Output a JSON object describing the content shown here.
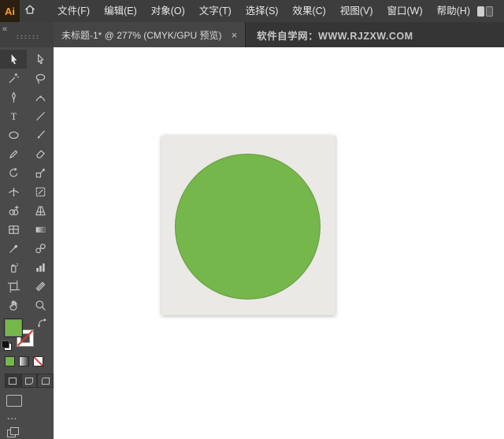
{
  "app": {
    "logo_text": "Ai"
  },
  "menubar": {
    "items": [
      {
        "id": "file",
        "label": "文件(F)"
      },
      {
        "id": "edit",
        "label": "编辑(E)"
      },
      {
        "id": "object",
        "label": "对象(O)"
      },
      {
        "id": "type",
        "label": "文字(T)"
      },
      {
        "id": "select",
        "label": "选择(S)"
      },
      {
        "id": "effect",
        "label": "效果(C)"
      },
      {
        "id": "view",
        "label": "视图(V)"
      },
      {
        "id": "window",
        "label": "窗口(W)"
      },
      {
        "id": "help",
        "label": "帮助(H)"
      }
    ]
  },
  "tabbar": {
    "document_tab": {
      "title": "未标题-1* @ 277% (CMYK/GPU 预览)",
      "close_label": "×"
    },
    "watermark": "软件自学网：WWW.RJZXW.COM",
    "collapse_glyph": "«"
  },
  "toolbar": {
    "tools": [
      "selection",
      "direct-selection",
      "magic-wand",
      "lasso",
      "pen",
      "curvature",
      "type",
      "line-segment",
      "ellipse",
      "paintbrush",
      "pencil",
      "eraser",
      "rotate",
      "scale",
      "width",
      "free-transform",
      "shape-builder",
      "perspective-grid",
      "mesh",
      "gradient",
      "eyedropper",
      "blend",
      "symbol-sprayer",
      "column-graph",
      "artboard",
      "slice",
      "hand",
      "zoom"
    ],
    "active_tool": "selection",
    "edit_toolbar_glyph": "…"
  },
  "colors": {
    "fill": "#76b74b",
    "stroke": "none",
    "logo_orange": "#ff9c2a",
    "menubar_bg": "#3d3d3d",
    "toolbar_bg": "#4a4a4a",
    "canvas_bg": "#ffffff",
    "artboard_bg": "#eae9e6"
  },
  "canvas": {
    "zoom_percent": 277,
    "color_mode": "CMYK",
    "preview_mode": "GPU 预览",
    "shape": {
      "type": "ellipse",
      "fill": "#76b74b"
    }
  }
}
